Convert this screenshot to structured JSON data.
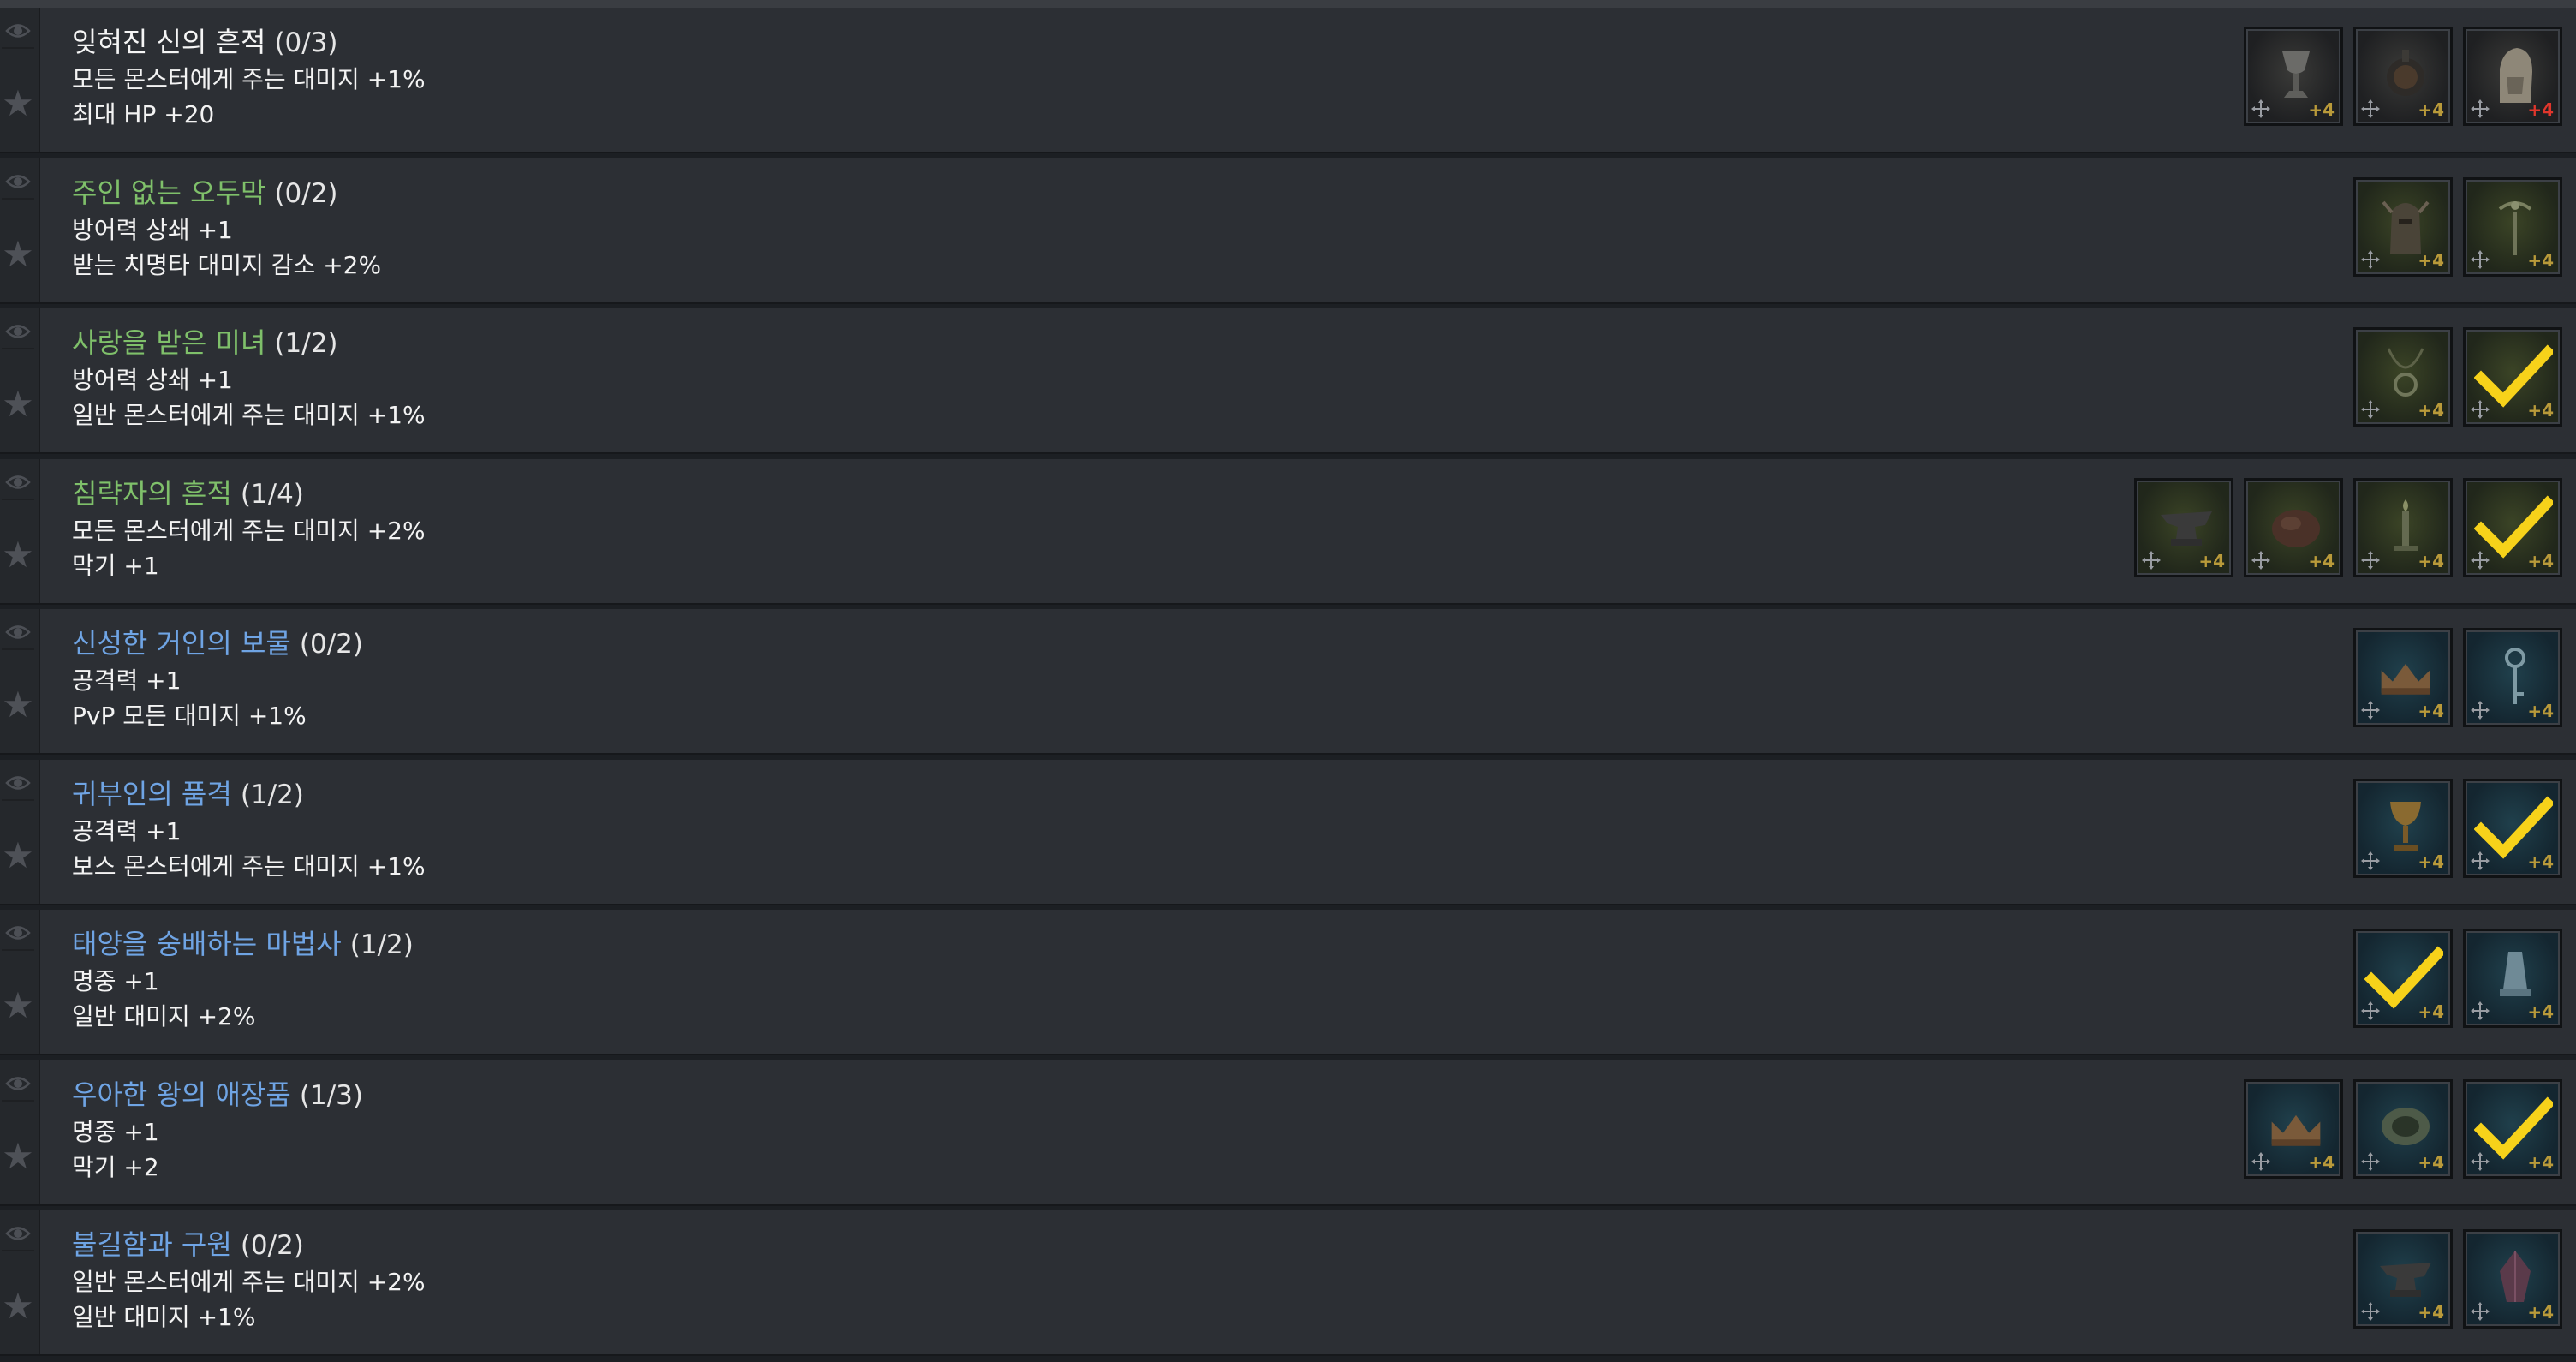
{
  "colors": {
    "white_title": "#f5f5f5",
    "green_title": "#7fc06a",
    "blue_title": "#6fa4e4",
    "check": "#f7d21a",
    "level": "#b99a3a",
    "level_red": "#e0362c"
  },
  "sets": [
    {
      "name": "잊혀진 신의 흔적",
      "count": "(0/3)",
      "grade": "white",
      "stats": [
        "모든 몬스터에게 주는 대미지 +1%",
        "최대 HP +20"
      ],
      "items": [
        {
          "icon": "chalice-icon",
          "bg": "w",
          "level": "+4",
          "checked": false
        },
        {
          "icon": "orb-icon",
          "bg": "w",
          "level": "+4",
          "checked": false
        },
        {
          "icon": "hand-relic-icon",
          "bg": "w",
          "level": "+4",
          "checked": false,
          "red": true
        }
      ]
    },
    {
      "name": "주인 없는 오두막",
      "count": "(0/2)",
      "grade": "green",
      "stats": [
        "방어력 상쇄 +1",
        "받는 치명타 대미지 감소 +2%"
      ],
      "items": [
        {
          "icon": "helmet-icon",
          "bg": "g",
          "level": "+4",
          "checked": false
        },
        {
          "icon": "scepter-icon",
          "bg": "g",
          "level": "+4",
          "checked": false
        }
      ]
    },
    {
      "name": "사랑을 받은 미녀",
      "count": "(1/2)",
      "grade": "green",
      "stats": [
        "방어력 상쇄 +1",
        "일반 몬스터에게 주는 대미지 +1%"
      ],
      "items": [
        {
          "icon": "necklace-icon",
          "bg": "g",
          "level": "+4",
          "checked": false
        },
        {
          "icon": "check-icon",
          "bg": "g",
          "level": "+4",
          "checked": true
        }
      ]
    },
    {
      "name": "침략자의 흔적",
      "count": "(1/4)",
      "grade": "green",
      "stats": [
        "모든 몬스터에게 주는 대미지 +2%",
        "막기 +1"
      ],
      "items": [
        {
          "icon": "anvil-icon",
          "bg": "g",
          "level": "+4",
          "checked": false
        },
        {
          "icon": "stone-icon",
          "bg": "g",
          "level": "+4",
          "checked": false
        },
        {
          "icon": "candle-icon",
          "bg": "g",
          "level": "+4",
          "checked": false
        },
        {
          "icon": "check-icon",
          "bg": "g",
          "level": "+4",
          "checked": true
        }
      ]
    },
    {
      "name": "신성한 거인의 보물",
      "count": "(0/2)",
      "grade": "blue",
      "stats": [
        "공격력 +1",
        "PvP 모든 대미지 +1%"
      ],
      "items": [
        {
          "icon": "crown-icon",
          "bg": "b",
          "level": "+4",
          "checked": false
        },
        {
          "icon": "key-icon",
          "bg": "b",
          "level": "+4",
          "checked": false
        }
      ]
    },
    {
      "name": "귀부인의 품격",
      "count": "(1/2)",
      "grade": "blue",
      "stats": [
        "공격력 +1",
        "보스 몬스터에게 주는 대미지 +1%"
      ],
      "items": [
        {
          "icon": "goblet-icon",
          "bg": "b",
          "level": "+4",
          "checked": false
        },
        {
          "icon": "check-icon",
          "bg": "b",
          "level": "+4",
          "checked": true
        }
      ]
    },
    {
      "name": "태양을 숭배하는 마법사",
      "count": "(1/2)",
      "grade": "blue",
      "stats": [
        "명중 +1",
        "일반 대미지 +2%"
      ],
      "items": [
        {
          "icon": "check-icon",
          "bg": "b",
          "level": "+4",
          "checked": true
        },
        {
          "icon": "bell-icon",
          "bg": "b",
          "level": "+4",
          "checked": false
        }
      ]
    },
    {
      "name": "우아한 왕의 애장품",
      "count": "(1/3)",
      "grade": "blue",
      "stats": [
        "명중 +1",
        "막기 +2"
      ],
      "items": [
        {
          "icon": "crown-icon",
          "bg": "b",
          "level": "+4",
          "checked": false
        },
        {
          "icon": "bowl-icon",
          "bg": "b",
          "level": "+4",
          "checked": false
        },
        {
          "icon": "check-icon",
          "bg": "b",
          "level": "+4",
          "checked": true
        }
      ]
    },
    {
      "name": "불길함과 구원",
      "count": "(0/2)",
      "grade": "blue",
      "stats": [
        "일반 몬스터에게 주는 대미지 +2%",
        "일반 대미지 +1%"
      ],
      "items": [
        {
          "icon": "anvil-icon",
          "bg": "b",
          "level": "+4",
          "checked": false
        },
        {
          "icon": "crystal-icon",
          "bg": "b",
          "level": "+4",
          "checked": false
        }
      ]
    }
  ]
}
